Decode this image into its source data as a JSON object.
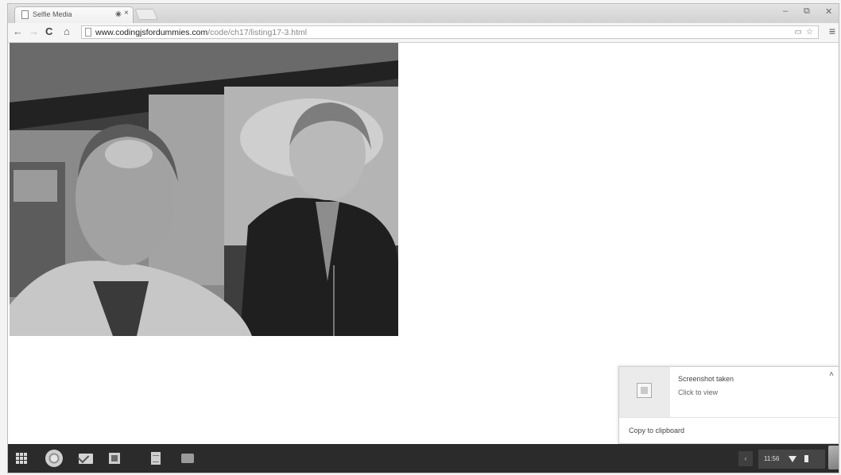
{
  "browser": {
    "tab": {
      "title": "Selfie Media",
      "audio_icon": "speaker-icon",
      "close_glyph": "×"
    },
    "window_controls": {
      "minimize": "–",
      "restore": "⧉",
      "close": "✕"
    },
    "toolbar": {
      "back": "←",
      "forward": "→",
      "reload": "C",
      "home": "⌂",
      "url_host": "www.codingjsfordummies.com",
      "url_path": "/code/ch17/listing17-3.html",
      "menu": "≡"
    }
  },
  "content": {
    "photo": {
      "subject": "webcam-selfie"
    }
  },
  "notification": {
    "title": "Screenshot taken",
    "message": "Click to view",
    "action": "Copy to clipboard",
    "collapse_glyph": "˄"
  },
  "shelf": {
    "apps": [
      "launcher-icon",
      "chrome-icon",
      "gmail-icon",
      "photos-icon",
      "docs-icon",
      "video-icon"
    ],
    "status_arrow": "‹",
    "clock": "11:56"
  }
}
